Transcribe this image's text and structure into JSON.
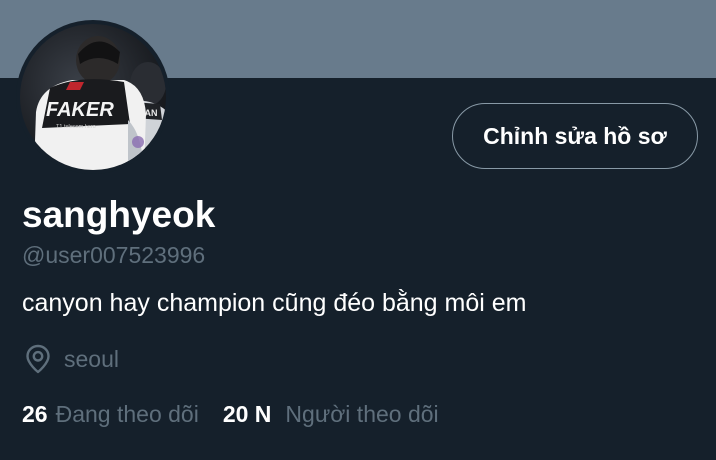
{
  "profile": {
    "display_name": "sanghyeok",
    "handle": "@user007523996",
    "bio": "canyon hay champion cũng đéo bằng môi em",
    "location": "seoul",
    "location_icon": "location-pin-icon",
    "avatar_jersey_text": "FAKER",
    "avatar_jersey_small_text": "T1 telecom hero",
    "avatar_sleeve_text": "HAN"
  },
  "actions": {
    "edit_profile_label": "Chỉnh sửa hồ sơ"
  },
  "stats": {
    "following_count": "26",
    "following_label": "Đang theo dõi",
    "followers_count": "20 N",
    "followers_label": "Người theo dõi"
  },
  "colors": {
    "background": "#15202b",
    "banner": "#687b8c",
    "primary_text": "#ffffff",
    "secondary_text": "#5f6f7c",
    "button_border": "#8899a6"
  }
}
